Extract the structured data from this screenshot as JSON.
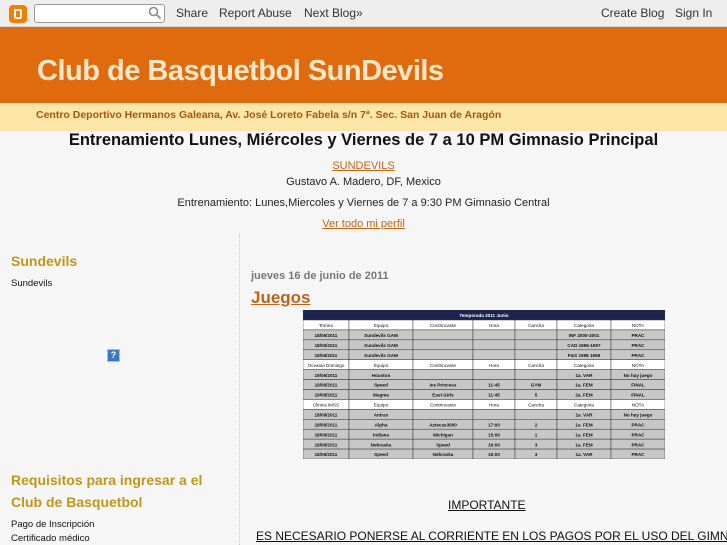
{
  "navbar": {
    "search_placeholder": "",
    "share": "Share",
    "report_abuse": "Report Abuse",
    "next_blog": "Next Blog»",
    "create_blog": "Create Blog",
    "sign_in": "Sign In"
  },
  "header": {
    "title": "Club de Basquetbol SunDevils",
    "description": "Centro Deportivo Hermanos Galeana, Av. José Loreto Fabela s/n 7ª. Sec. San Juan de Aragón"
  },
  "banner": "Entrenamiento Lunes, Miércoles y Viernes de 7 a 10 PM Gimnasio Principal",
  "profile": {
    "name": "SUNDEVILS",
    "location": "Gustavo A. Madero, DF, Mexico",
    "about": "Entrenamiento: Lunes,Miercoles y Viernes de 7 a 9:30 PM Gimnasio Central",
    "profile_link": "Ver todo mi perfil"
  },
  "sidebar": {
    "title1": "Sundevils",
    "text1": "Sundevils",
    "title2_line1": "Requisitos para ingresar a el",
    "title2_line2": "Club de Basquetbol",
    "items": [
      "Pago de Inscripción",
      "Certificado médico"
    ]
  },
  "post": {
    "date": "jueves 16 de junio de 2011",
    "title": "Juegos",
    "importante": "IMPORTANTE",
    "necesario": "ES NECESARIO PONERSE AL CORRIENTE EN LOS PAGOS POR EL USO DEL GIMNASIO"
  },
  "schedule": {
    "title": "Temporada 2011 Junio",
    "headers": [
      "Torneo",
      "Equipo",
      "Contrincante",
      "Hora",
      "Cancha",
      "Categoria",
      "NOTA"
    ],
    "rows": [
      {
        "type": "data",
        "cells": [
          "18/06/2011",
          "Sundevils GAM",
          "",
          "",
          "",
          "INF 2000-2001",
          "PRAC"
        ]
      },
      {
        "type": "data",
        "cells": [
          "18/06/2011",
          "Sundevils GAM",
          "",
          "",
          "",
          "CAD 1996-1997",
          "PRAC"
        ]
      },
      {
        "type": "data",
        "cells": [
          "18/06/2011",
          "Sundevils GAM",
          "",
          "",
          "",
          "P&S 1998 1999",
          "PRAC"
        ]
      },
      {
        "type": "header",
        "cells": [
          "Oceania Domingo",
          "Equipo",
          "Contrincante",
          "Hora",
          "Cancha",
          "Categoria",
          "NOTA"
        ]
      },
      {
        "type": "data",
        "cells": [
          "19/06/2011",
          "Houston",
          "",
          "",
          "",
          "1a. VAR",
          "No hay juego"
        ]
      },
      {
        "type": "data",
        "cells": [
          "19/06/2011",
          "Speed",
          "Ice Princess",
          "11:45",
          "GYM",
          "1a. FEM",
          "FINAL"
        ]
      },
      {
        "type": "data",
        "cells": [
          "19/06/2011",
          "Magma",
          "East Girls",
          "11:45",
          "5",
          "2a. FEM",
          "FINAL"
        ]
      },
      {
        "type": "header",
        "cells": [
          "Clinica IMSS",
          "Equipo",
          "Contrincante",
          "Hora",
          "Cancha",
          "Categoria",
          "NOTA"
        ]
      },
      {
        "type": "data",
        "cells": [
          "18/06/2011",
          "Antrax",
          "",
          "",
          "",
          "1a. VAR",
          "No hay juego"
        ]
      },
      {
        "type": "data",
        "cells": [
          "18/06/2011",
          "Alpha",
          "Aztecas3000",
          "17:00",
          "2",
          "1a. FEM",
          "PRAC"
        ]
      },
      {
        "type": "data",
        "cells": [
          "18/06/2011",
          "Indiana",
          "Michigan",
          "15:00",
          "1",
          "1a. FEM",
          "PRAC"
        ]
      },
      {
        "type": "data",
        "cells": [
          "18/06/2011",
          "Nebraska",
          "Speed",
          "16:00",
          "3",
          "1a. FEM",
          "PRAC"
        ]
      },
      {
        "type": "data",
        "cells": [
          "18/06/2011",
          "Speed",
          "Nebraska",
          "16:00",
          "3",
          "1a. VAR",
          "PRAC"
        ]
      }
    ]
  }
}
